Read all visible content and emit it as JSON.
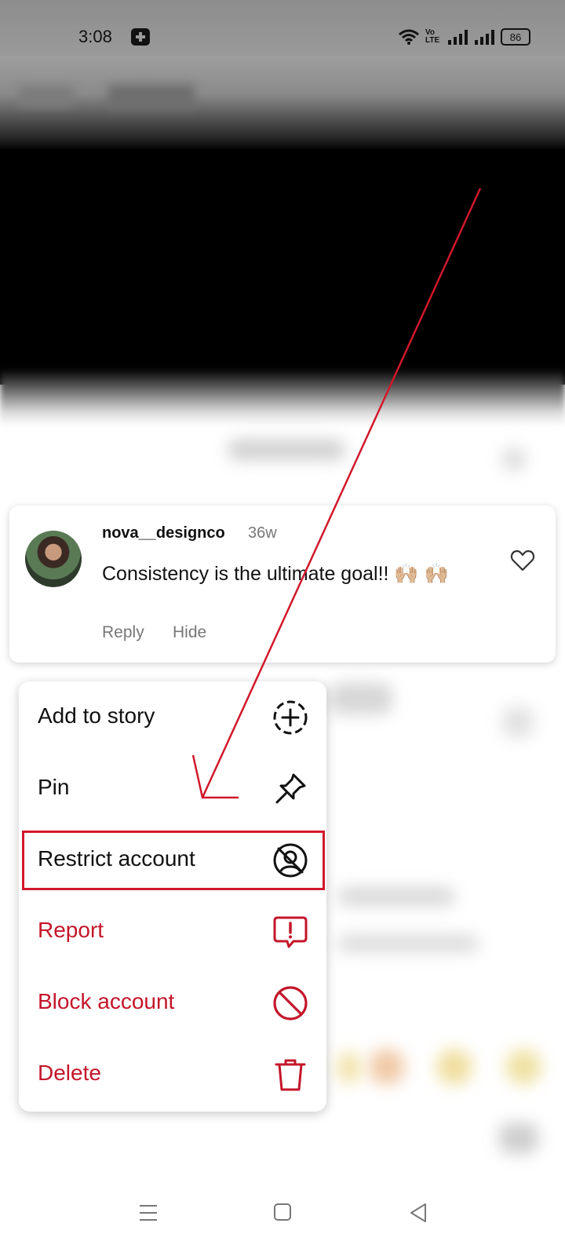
{
  "status_bar": {
    "time": "3:08",
    "battery": "86",
    "volte": "Vo LTE"
  },
  "comment": {
    "username": "nova__designco",
    "time_ago": "36w",
    "text": "Consistency is the ultimate goal!! 🙌🏼 🙌🏼",
    "reply_label": "Reply",
    "hide_label": "Hide"
  },
  "menu": {
    "items": [
      {
        "label": "Add to story",
        "icon": "add-story-icon",
        "danger": false
      },
      {
        "label": "Pin",
        "icon": "pin-icon",
        "danger": false
      },
      {
        "label": "Restrict account",
        "icon": "restrict-icon",
        "danger": false
      },
      {
        "label": "Report",
        "icon": "report-icon",
        "danger": true
      },
      {
        "label": "Block account",
        "icon": "block-icon",
        "danger": true
      },
      {
        "label": "Delete",
        "icon": "trash-icon",
        "danger": true
      }
    ]
  },
  "colors": {
    "danger": "#c4162a",
    "annotation": "#d1182b",
    "text": "#111111",
    "muted": "#777777"
  }
}
